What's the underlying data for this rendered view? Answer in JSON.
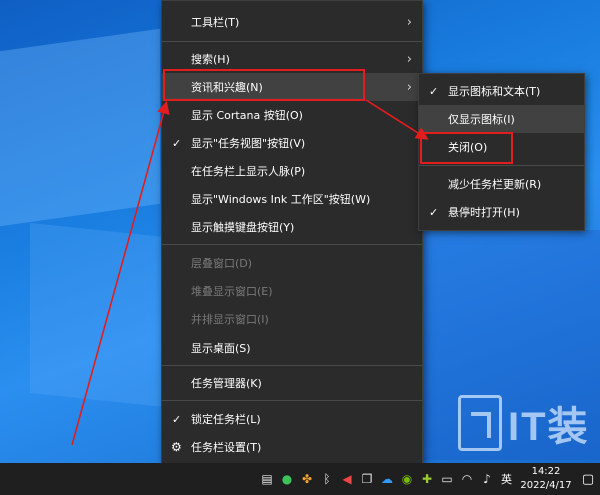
{
  "main_menu": {
    "items": [
      {
        "label": "工具栏(T)",
        "submenu": true
      },
      {
        "label": "搜索(H)",
        "submenu": true
      },
      {
        "label": "资讯和兴趣(N)",
        "submenu": true,
        "highlighted": true
      },
      {
        "label": "显示 Cortana 按钮(O)"
      },
      {
        "label": "显示\"任务视图\"按钮(V)",
        "checked": true
      },
      {
        "label": "在任务栏上显示人脉(P)"
      },
      {
        "label": "显示\"Windows Ink 工作区\"按钮(W)"
      },
      {
        "label": "显示触摸键盘按钮(Y)"
      },
      {
        "label": "层叠窗口(D)",
        "disabled": true
      },
      {
        "label": "堆叠显示窗口(E)",
        "disabled": true
      },
      {
        "label": "并排显示窗口(I)",
        "disabled": true
      },
      {
        "label": "显示桌面(S)"
      },
      {
        "label": "任务管理器(K)"
      },
      {
        "label": "锁定任务栏(L)",
        "checked": true
      },
      {
        "label": "任务栏设置(T)",
        "icon": "gear-icon"
      }
    ]
  },
  "sub_menu": {
    "items": [
      {
        "label": "显示图标和文本(T)",
        "checked": true
      },
      {
        "label": "仅显示图标(I)",
        "hover": true
      },
      {
        "label": "关闭(O)"
      },
      {
        "label": "减少任务栏更新(R)"
      },
      {
        "label": "悬停时打开(H)",
        "checked": true
      }
    ]
  },
  "taskbar": {
    "tray_icons": [
      "news-icon",
      "wechat-icon",
      "multicolor-icon",
      "bluetooth-icon",
      "speaker-icon",
      "copy-icon",
      "cloud-icon",
      "nvidia-icon",
      "plugin-icon",
      "battery-icon",
      "wifi-icon",
      "volume-icon"
    ],
    "ime": "英",
    "time": "14:22",
    "date": "2022/4/17"
  },
  "watermark": {
    "text": "IT装"
  },
  "colors": {
    "menu_bg": "#2b2b2b",
    "annotation": "#e21d1d",
    "desktop": "#1a7ee0"
  },
  "checkmark": "✓",
  "chevron": "›",
  "gear": "⚙"
}
